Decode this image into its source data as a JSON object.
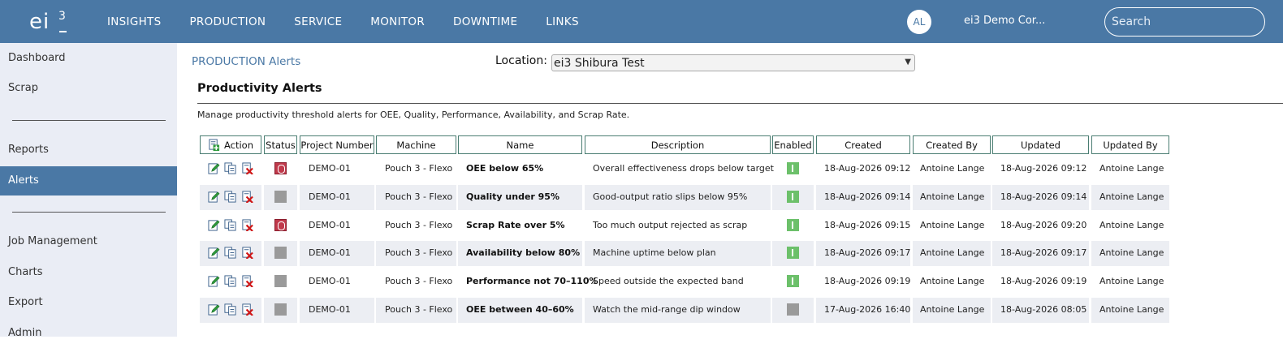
{
  "brand": {
    "logo_text": "ei",
    "logo_superscript": "3"
  },
  "nav": [
    "INSIGHTS",
    "PRODUCTION",
    "SERVICE",
    "MONITOR",
    "DOWNTIME",
    "LINKS"
  ],
  "user": {
    "initials": "AL",
    "company": "ei3 Demo Cor..."
  },
  "search": {
    "placeholder": "Search"
  },
  "sidebar": {
    "items": [
      "Dashboard",
      "Scrap",
      "Reports",
      "Alerts",
      "Job Management",
      "Charts",
      "Export",
      "Admin"
    ],
    "active": "Alerts"
  },
  "page": {
    "breadcrumb": "PRODUCTION Alerts",
    "location_label": "Location:",
    "location_value": "ei3 Shibura Test",
    "title": "Productivity Alerts",
    "description": "Manage productivity threshold alerts for OEE, Quality, Performance, Availability, and Scrap Rate."
  },
  "table": {
    "headers": [
      "Action",
      "Status",
      "Project Number",
      "Machine",
      "Name",
      "Description",
      "Enabled",
      "Created",
      "Created By",
      "Updated",
      "Updated By"
    ],
    "rows": [
      {
        "status": "triggered",
        "project": "DEMO-01",
        "machine": "Pouch 3 - Flexo",
        "name": "OEE below 65%",
        "description": "Overall effectiveness drops below target",
        "enabled": true,
        "created": "18-Aug-2026 09:12",
        "created_by": "Antoine Lange",
        "updated": "18-Aug-2026 09:12",
        "updated_by": "Antoine Lange"
      },
      {
        "status": "idle",
        "project": "DEMO-01",
        "machine": "Pouch 3 - Flexo",
        "name": "Quality under 95%",
        "description": "Good-output ratio slips below 95%",
        "enabled": true,
        "created": "18-Aug-2026 09:14",
        "created_by": "Antoine Lange",
        "updated": "18-Aug-2026 09:14",
        "updated_by": "Antoine Lange"
      },
      {
        "status": "triggered",
        "project": "DEMO-01",
        "machine": "Pouch 3 - Flexo",
        "name": "Scrap Rate over 5%",
        "description": "Too much output rejected as scrap",
        "enabled": true,
        "created": "18-Aug-2026 09:15",
        "created_by": "Antoine Lange",
        "updated": "18-Aug-2026 09:20",
        "updated_by": "Antoine Lange"
      },
      {
        "status": "idle",
        "project": "DEMO-01",
        "machine": "Pouch 3 - Flexo",
        "name": "Availability below 80%",
        "description": "Machine uptime below plan",
        "enabled": true,
        "created": "18-Aug-2026 09:17",
        "created_by": "Antoine Lange",
        "updated": "18-Aug-2026 09:17",
        "updated_by": "Antoine Lange"
      },
      {
        "status": "idle",
        "project": "DEMO-01",
        "machine": "Pouch 3 - Flexo",
        "name": "Performance not 70–110%",
        "description": "Speed outside the expected band",
        "enabled": true,
        "created": "18-Aug-2026 09:19",
        "created_by": "Antoine Lange",
        "updated": "18-Aug-2026 09:19",
        "updated_by": "Antoine Lange"
      },
      {
        "status": "idle",
        "project": "DEMO-01",
        "machine": "Pouch 3 - Flexo",
        "name": "OEE between 40–60%",
        "description": "Watch the mid-range dip window",
        "enabled": false,
        "created": "17-Aug-2026 16:40",
        "created_by": "Antoine Lange",
        "updated": "18-Aug-2026 08:05",
        "updated_by": "Antoine Lange"
      }
    ]
  },
  "colors": {
    "primary": "#4a78a5",
    "sidebar_bg": "#eaedf5",
    "row_alt": "#eceef3",
    "triggered": "#c0394b",
    "enabled": "#6cc06a",
    "disabled": "#9a9a9a",
    "header_border": "#4a7d72"
  },
  "icons": {
    "add": "add-alert-icon",
    "edit": "edit-icon",
    "copy": "copy-icon",
    "delete": "delete-icon"
  }
}
